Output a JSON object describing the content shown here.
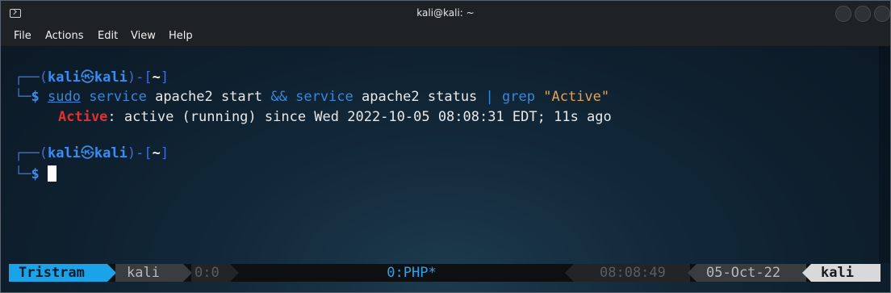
{
  "window": {
    "title": "kali@kali: ~"
  },
  "menu": [
    "File",
    "Actions",
    "Edit",
    "View",
    "Help"
  ],
  "prompt": {
    "user": "kali",
    "host": "kali",
    "skull": "㉿",
    "dir": "~",
    "symbol": "$",
    "box_top": "┌──(",
    "box_mid": ")-[",
    "box_end": "]",
    "box_bottom": "└─"
  },
  "command": {
    "sudo": "sudo",
    "service1": "service",
    "args1": " apache2 start ",
    "and": "&&",
    "service2": "service",
    "args2": " apache2 status ",
    "pipe": "|",
    "grep": "grep",
    "pattern": "\"Active\""
  },
  "output": {
    "keyword": "Active",
    "rest": ": active (running) since Wed 2022-10-05 08:08:31 EDT; 11s ago"
  },
  "statusbar": {
    "session": "Tristram",
    "user": "kali",
    "pane": "0:0",
    "window": "0:PHP*",
    "time": "08:08:49",
    "date": "05-Oct-22",
    "host": "kali"
  },
  "colors": {
    "accent": "#1aa3e8",
    "prompt_blue": "#3c8cf0",
    "error_red": "#e03030",
    "string_orange": "#e0a25a"
  }
}
